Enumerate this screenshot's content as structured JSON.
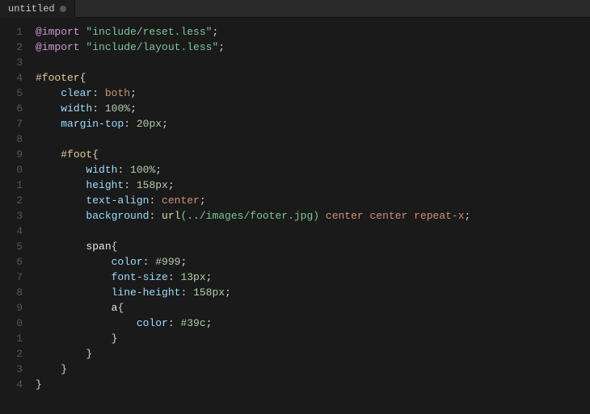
{
  "tab": {
    "title": "untitled",
    "dot_visible": true
  },
  "lines": [
    {
      "number": "1",
      "tokens": [
        {
          "text": "@import",
          "class": "at-rule"
        },
        {
          "text": " ",
          "class": ""
        },
        {
          "text": "\"include/reset.less\"",
          "class": "str"
        },
        {
          "text": ";",
          "class": "punct"
        }
      ]
    },
    {
      "number": "2",
      "tokens": [
        {
          "text": "@import",
          "class": "at-rule"
        },
        {
          "text": " ",
          "class": ""
        },
        {
          "text": "\"include/layout.less\"",
          "class": "str"
        },
        {
          "text": ";",
          "class": "punct"
        }
      ]
    },
    {
      "number": "3",
      "tokens": []
    },
    {
      "number": "4",
      "tokens": [
        {
          "text": "#footer",
          "class": "id-selector"
        },
        {
          "text": "{",
          "class": "punct"
        }
      ]
    },
    {
      "number": "5",
      "tokens": [
        {
          "text": "    ",
          "class": ""
        },
        {
          "text": "clear",
          "class": "property"
        },
        {
          "text": ": ",
          "class": "punct"
        },
        {
          "text": "both",
          "class": "value"
        },
        {
          "text": ";",
          "class": "punct"
        }
      ]
    },
    {
      "number": "6",
      "tokens": [
        {
          "text": "    ",
          "class": ""
        },
        {
          "text": "width",
          "class": "property"
        },
        {
          "text": ": ",
          "class": "punct"
        },
        {
          "text": "100%",
          "class": "value-num"
        },
        {
          "text": ";",
          "class": "punct"
        }
      ]
    },
    {
      "number": "7",
      "tokens": [
        {
          "text": "    ",
          "class": ""
        },
        {
          "text": "margin-top",
          "class": "property"
        },
        {
          "text": ": ",
          "class": "punct"
        },
        {
          "text": "20px",
          "class": "value-num"
        },
        {
          "text": ";",
          "class": "punct"
        }
      ]
    },
    {
      "number": "8",
      "tokens": []
    },
    {
      "number": "9",
      "tokens": [
        {
          "text": "    ",
          "class": ""
        },
        {
          "text": "#foot",
          "class": "id-selector"
        },
        {
          "text": "{",
          "class": "punct"
        }
      ]
    },
    {
      "number": "0",
      "tokens": [
        {
          "text": "        ",
          "class": ""
        },
        {
          "text": "width",
          "class": "property"
        },
        {
          "text": ": ",
          "class": "punct"
        },
        {
          "text": "100%",
          "class": "value-num"
        },
        {
          "text": ";",
          "class": "punct"
        }
      ]
    },
    {
      "number": "1",
      "tokens": [
        {
          "text": "        ",
          "class": ""
        },
        {
          "text": "height",
          "class": "property"
        },
        {
          "text": ": ",
          "class": "punct"
        },
        {
          "text": "158px",
          "class": "value-num"
        },
        {
          "text": ";",
          "class": "punct"
        }
      ]
    },
    {
      "number": "2",
      "tokens": [
        {
          "text": "        ",
          "class": ""
        },
        {
          "text": "text-align",
          "class": "property"
        },
        {
          "text": ": ",
          "class": "punct"
        },
        {
          "text": "center",
          "class": "value"
        },
        {
          "text": ";",
          "class": "punct"
        }
      ]
    },
    {
      "number": "3",
      "tokens": [
        {
          "text": "        ",
          "class": ""
        },
        {
          "text": "background",
          "class": "property"
        },
        {
          "text": ": ",
          "class": "punct"
        },
        {
          "text": "url",
          "class": "url-fn"
        },
        {
          "text": "(../images/footer.jpg)",
          "class": "str"
        },
        {
          "text": " center center repeat-x",
          "class": "value"
        },
        {
          "text": ";",
          "class": "punct"
        }
      ]
    },
    {
      "number": "4",
      "tokens": []
    },
    {
      "number": "5",
      "tokens": [
        {
          "text": "        ",
          "class": ""
        },
        {
          "text": "span",
          "class": "selector"
        },
        {
          "text": "{",
          "class": "punct"
        }
      ]
    },
    {
      "number": "6",
      "tokens": [
        {
          "text": "            ",
          "class": ""
        },
        {
          "text": "color",
          "class": "property"
        },
        {
          "text": ": ",
          "class": "punct"
        },
        {
          "text": "#999",
          "class": "hash-color"
        },
        {
          "text": ";",
          "class": "punct"
        }
      ]
    },
    {
      "number": "7",
      "tokens": [
        {
          "text": "            ",
          "class": ""
        },
        {
          "text": "font-size",
          "class": "property"
        },
        {
          "text": ": ",
          "class": "punct"
        },
        {
          "text": "13px",
          "class": "value-num"
        },
        {
          "text": ";",
          "class": "punct"
        }
      ]
    },
    {
      "number": "8",
      "tokens": [
        {
          "text": "            ",
          "class": ""
        },
        {
          "text": "line-height",
          "class": "property"
        },
        {
          "text": ": ",
          "class": "punct"
        },
        {
          "text": "158px",
          "class": "value-num"
        },
        {
          "text": ";",
          "class": "punct"
        }
      ]
    },
    {
      "number": "9",
      "tokens": [
        {
          "text": "            ",
          "class": ""
        },
        {
          "text": "a",
          "class": "selector"
        },
        {
          "text": "{",
          "class": "punct"
        }
      ]
    },
    {
      "number": "0",
      "tokens": [
        {
          "text": "                ",
          "class": ""
        },
        {
          "text": "color",
          "class": "property"
        },
        {
          "text": ": ",
          "class": "punct"
        },
        {
          "text": "#39c",
          "class": "hash-color"
        },
        {
          "text": ";",
          "class": "punct"
        }
      ]
    },
    {
      "number": "1",
      "tokens": [
        {
          "text": "            ",
          "class": ""
        },
        {
          "text": "}",
          "class": "punct"
        }
      ]
    },
    {
      "number": "2",
      "tokens": [
        {
          "text": "        ",
          "class": ""
        },
        {
          "text": "}",
          "class": "punct"
        }
      ]
    },
    {
      "number": "3",
      "tokens": [
        {
          "text": "    ",
          "class": ""
        },
        {
          "text": "}",
          "class": "punct"
        }
      ]
    },
    {
      "number": "4",
      "tokens": [
        {
          "text": "}",
          "class": "punct"
        }
      ]
    }
  ]
}
